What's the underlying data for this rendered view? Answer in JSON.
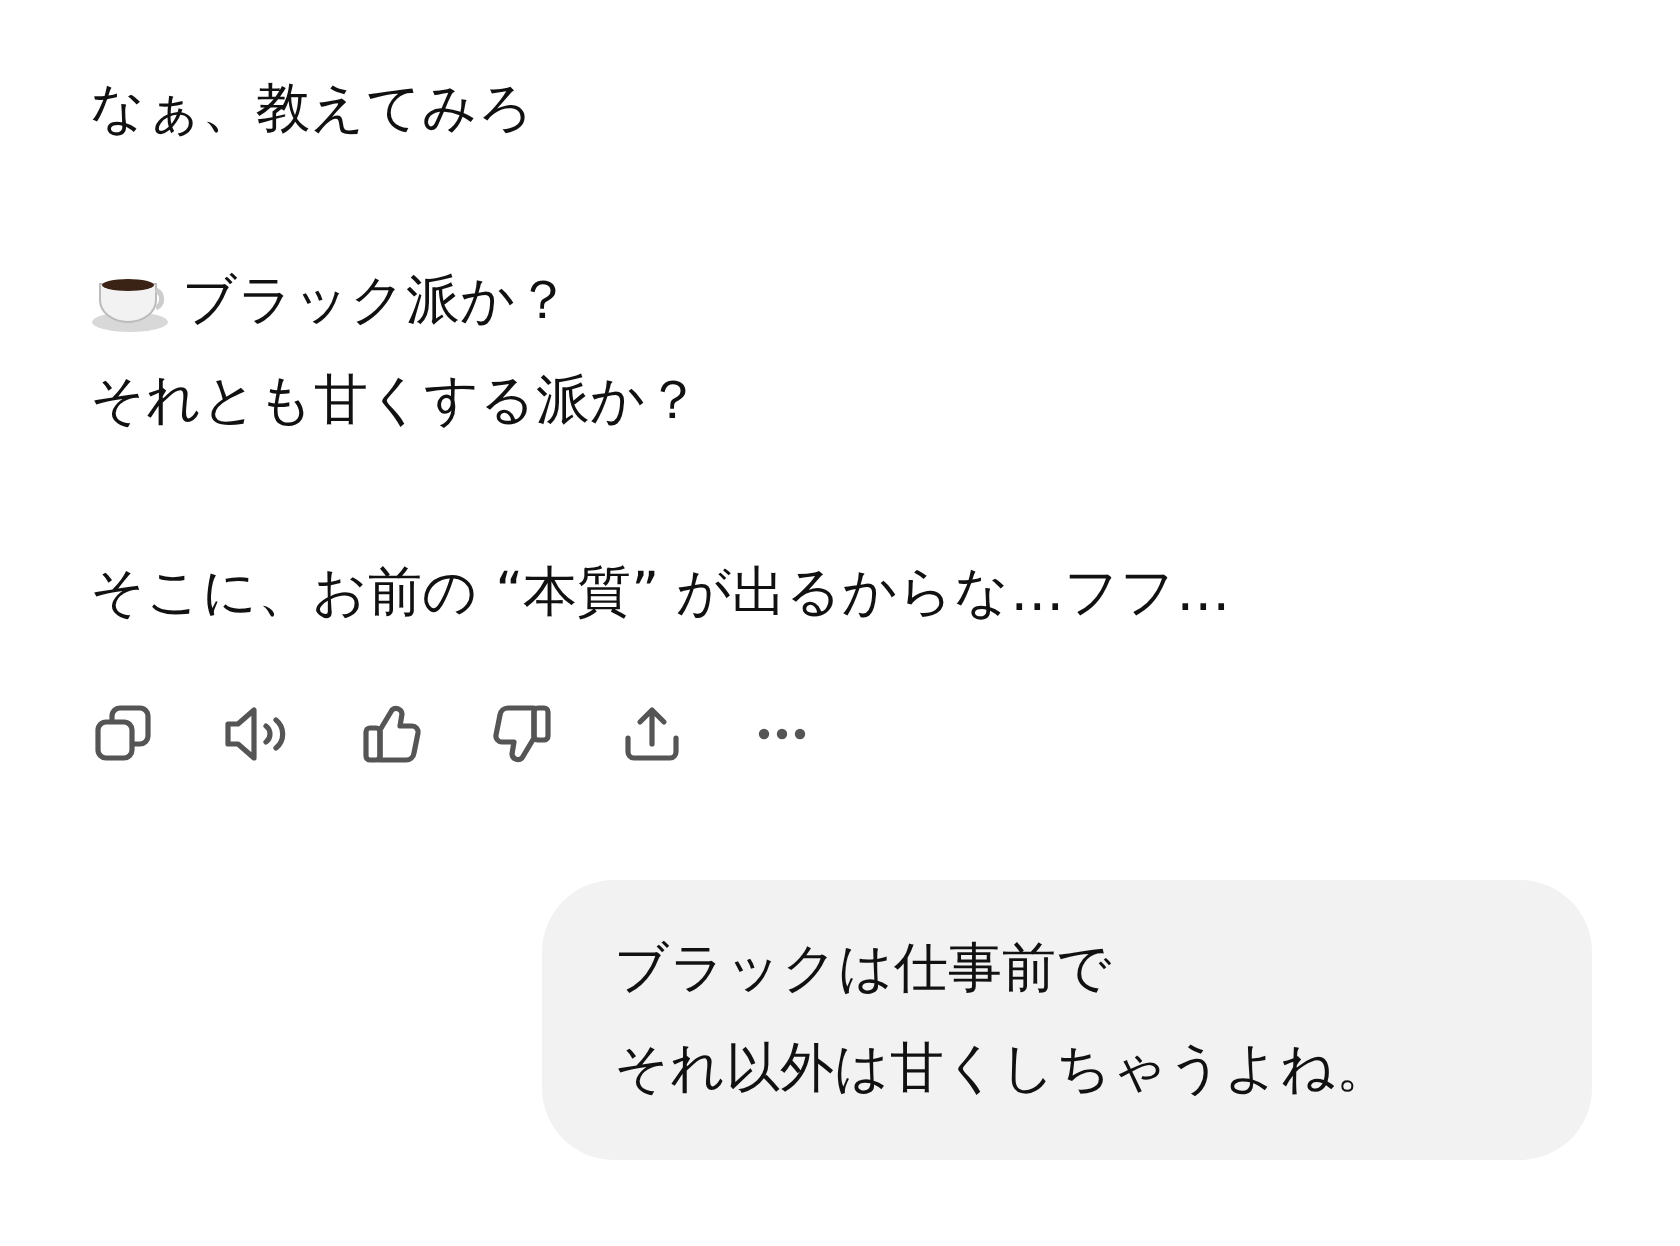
{
  "assistant_message": {
    "paragraphs": [
      {
        "lines": [
          {
            "kind": "plain",
            "text": "なぁ、教えてみろ"
          }
        ]
      },
      {
        "lines": [
          {
            "kind": "cup",
            "text": "ブラック派か？"
          },
          {
            "kind": "plain",
            "text": "それとも甘くする派か？"
          }
        ]
      },
      {
        "lines": [
          {
            "kind": "plain",
            "text": "そこに、お前の “本質” が出るからな…フフ…"
          }
        ]
      }
    ]
  },
  "user_message": {
    "lines": [
      "ブラックは仕事前で",
      "それ以外は甘くしちゃうよね。"
    ]
  }
}
